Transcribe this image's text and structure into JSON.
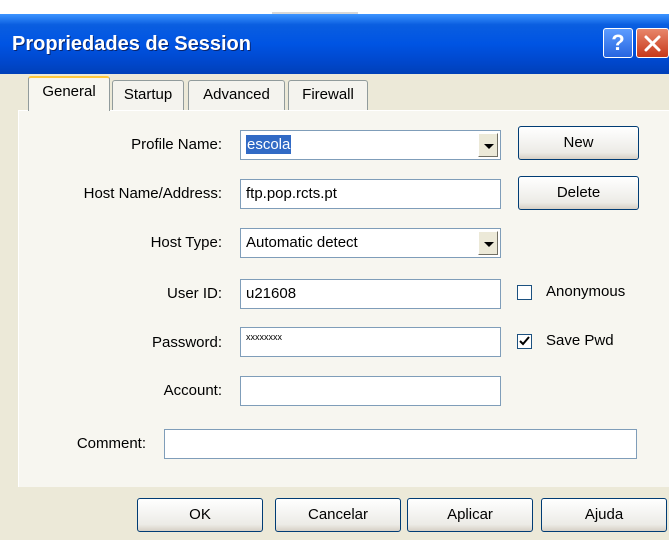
{
  "window": {
    "title": "Propriedades de Session",
    "help_glyph": "?",
    "close_icon": "close-icon"
  },
  "tabs": [
    {
      "label": "General",
      "active": true
    },
    {
      "label": "Startup",
      "active": false
    },
    {
      "label": "Advanced",
      "active": false
    },
    {
      "label": "Firewall",
      "active": false
    }
  ],
  "form": {
    "profile_name": {
      "label": "Profile Name:",
      "value": "escola"
    },
    "host_name": {
      "label": "Host Name/Address:",
      "value": "ftp.pop.rcts.pt"
    },
    "host_type": {
      "label": "Host Type:",
      "value": "Automatic detect"
    },
    "user_id": {
      "label": "User ID:",
      "value": "u21608"
    },
    "password": {
      "label": "Password:",
      "value": "xxxxxxxx"
    },
    "account": {
      "label": "Account:",
      "value": ""
    },
    "comment": {
      "label": "Comment:",
      "value": ""
    }
  },
  "side_buttons": {
    "new": "New",
    "delete": "Delete"
  },
  "checkboxes": {
    "anonymous": {
      "label": "Anonymous",
      "checked": false
    },
    "save_pwd": {
      "label": "Save Pwd",
      "checked": true
    }
  },
  "footer_buttons": {
    "ok": "OK",
    "cancel": "Cancelar",
    "apply": "Aplicar",
    "help": "Ajuda"
  },
  "colors": {
    "titlebar": "#0054e3",
    "selection": "#316ac5",
    "face": "#ece9d8"
  }
}
